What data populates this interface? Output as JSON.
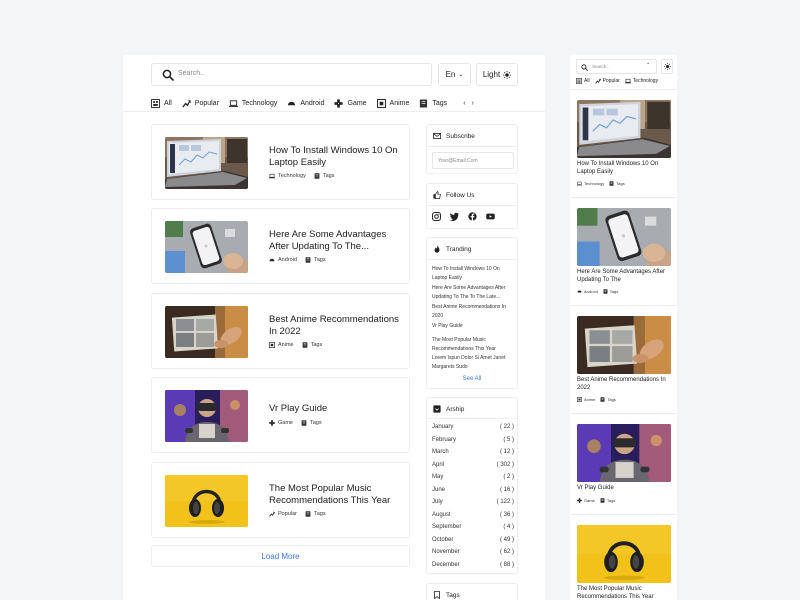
{
  "header": {
    "search_placeholder": "Search..",
    "language": "En",
    "theme_label": "Light"
  },
  "categories": [
    {
      "label": "All",
      "icon": "grid-icon"
    },
    {
      "label": "Popular",
      "icon": "trending-icon"
    },
    {
      "label": "Technology",
      "icon": "laptop-icon"
    },
    {
      "label": "Android",
      "icon": "android-icon"
    },
    {
      "label": "Game",
      "icon": "gamepad-icon"
    },
    {
      "label": "Anime",
      "icon": "anime-icon"
    },
    {
      "label": "Tags",
      "icon": "tag-icon"
    }
  ],
  "articles": [
    {
      "title": "How To Install Windows 10 On Laptop Easily",
      "category": "Technology",
      "tag": "Tags",
      "image": "laptop"
    },
    {
      "title": "Here Are Some Advantages After Updating To The...",
      "category": "Android",
      "tag": "Tags",
      "image": "phone"
    },
    {
      "title": "Best Anime Recommendations In 2022",
      "category": "Anime",
      "tag": "Tags",
      "image": "anime"
    },
    {
      "title": "Vr Play Guide",
      "category": "Game",
      "tag": "Tags",
      "image": "vr"
    },
    {
      "title": "The Most Popular Music Recommendations This Year",
      "category": "Popular",
      "tag": "Tags",
      "image": "headphones"
    }
  ],
  "load_more": "Load More",
  "sidebar": {
    "subscribe": {
      "title": "Subscribe",
      "placeholder": "Your@Email.Com"
    },
    "follow": {
      "title": "Follow Us",
      "networks": [
        "instagram-icon",
        "twitter-icon",
        "facebook-icon",
        "youtube-icon"
      ]
    },
    "trending": {
      "title": "Tranding",
      "items": [
        "How To Install Windows 10 On Laptop Easily",
        "Here Are Some Advantages After Updating To The To The Late...",
        "Best Anime Recommendations In 2020",
        "Vr Play Guide",
        "The Most Popular Music Recommendations This Year",
        "Lorem Ispun Dolor Si Amet Janet Margarets Sudo"
      ],
      "see_all": "See All"
    },
    "archive": {
      "title": "Arship",
      "months": [
        {
          "month": "January",
          "count": "( 22 )"
        },
        {
          "month": "February",
          "count": "( 5 )"
        },
        {
          "month": "March",
          "count": "( 12 )"
        },
        {
          "month": "April",
          "count": "( 302 )"
        },
        {
          "month": "May",
          "count": "( 2 )"
        },
        {
          "month": "June",
          "count": "( 16 )"
        },
        {
          "month": "July",
          "count": "( 122 )"
        },
        {
          "month": "August",
          "count": "( 36 )"
        },
        {
          "month": "September",
          "count": "( 4 )"
        },
        {
          "month": "October",
          "count": "( 49 )"
        },
        {
          "month": "November",
          "count": "( 62 )"
        },
        {
          "month": "December",
          "count": "( 88 )"
        }
      ]
    },
    "tags": {
      "title": "Tags"
    }
  },
  "mobile": {
    "search_placeholder": "Search..",
    "categories": [
      "All",
      "Popular",
      "Technology"
    ],
    "articles": [
      {
        "title": "How To Install Windows 10 On Laptop Easily",
        "category": "Technology",
        "tag": "Tags"
      },
      {
        "title": "Here Are Some Advantages After Updating To The",
        "category": "Android",
        "tag": "Tags"
      },
      {
        "title": "Best Anime Recommendations In 2022",
        "category": "Anime",
        "tag": "Tags"
      },
      {
        "title": "Vr Play Guide",
        "category": "Game",
        "tag": "Tags"
      },
      {
        "title": "The Most Popular Music Recommendations This Year",
        "category": "Popular",
        "tag": "Tags"
      }
    ]
  }
}
